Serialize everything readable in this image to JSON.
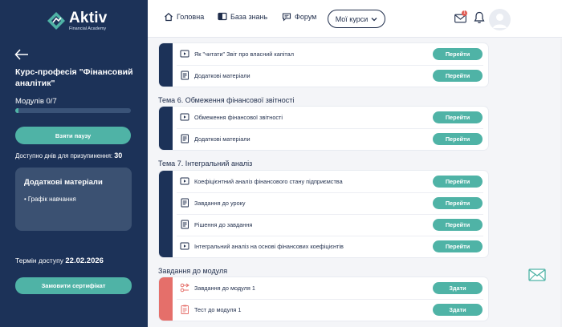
{
  "brand": {
    "name": "Aktiv",
    "tagline": "Financial Academy"
  },
  "sidebar": {
    "course_title": "Курс-професія \"Фінансовий аналітик\"",
    "modules_label": "Модулів 0/7",
    "modules_progress": 0,
    "pause_button": "Взяти паузу",
    "freeze_label": "Доступно днів для призупинення:",
    "freeze_days": "30",
    "extra_materials": {
      "title": "Додаткові матеріали",
      "items": [
        "• Графік навчання"
      ]
    },
    "access_label": "Термін доступу",
    "access_date": "22.02.2026",
    "certificate_button": "Замовити сертифікат"
  },
  "topbar": {
    "nav": [
      {
        "label": "Головна",
        "icon": "home-icon"
      },
      {
        "label": "База знань",
        "icon": "book-icon"
      },
      {
        "label": "Форум",
        "icon": "chat-icon"
      }
    ],
    "my_courses": "Мої курси",
    "mail_badge": "1"
  },
  "content": {
    "top_card": {
      "rows": [
        {
          "label": "Як \"читати\" Звіт про власний капітал",
          "icon": "video-icon",
          "action": "Перейти"
        },
        {
          "label": "Додаткові матеріали",
          "icon": "document-icon",
          "action": "Перейти"
        }
      ]
    },
    "sections": [
      {
        "title": "Тема 6. Обмеження фінансової звітності",
        "rows": [
          {
            "label": "Обмеження фінансової звітності",
            "icon": "video-icon",
            "action": "Перейти"
          },
          {
            "label": "Додаткові матеріали",
            "icon": "document-icon",
            "action": "Перейти"
          }
        ]
      },
      {
        "title": "Тема 7. Інтегральний аналіз",
        "rows": [
          {
            "label": "Коефіцієнтний аналіз фінансового стану підприємства",
            "icon": "video-icon",
            "action": "Перейти"
          },
          {
            "label": "Завдання до уроку",
            "icon": "document-icon",
            "action": "Перейти"
          },
          {
            "label": "Рішення до завдання",
            "icon": "document-icon",
            "action": "Перейти"
          },
          {
            "label": "Інтегральний аналіз на основі фінансових коефіцієнтів",
            "icon": "video-icon",
            "action": "Перейти"
          }
        ]
      },
      {
        "title": "Завдання до модуля",
        "rows": [
          {
            "label": "Завдання до модуля 1",
            "icon": "task-icon",
            "action": "Здати"
          },
          {
            "label": "Тест до модуля 1",
            "icon": "test-icon",
            "action": "Здати"
          }
        ]
      }
    ]
  },
  "colors": {
    "sidebar": "#1c3258",
    "accent": "#4fb3a6",
    "module_strip": "#e56f6a"
  }
}
